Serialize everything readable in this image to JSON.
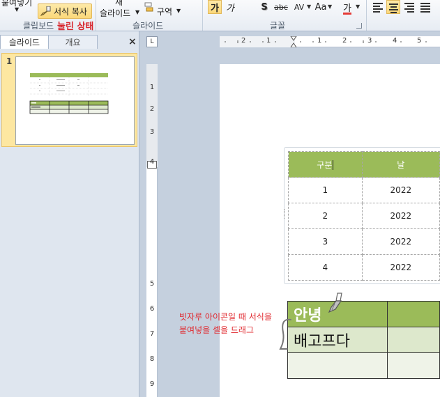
{
  "ribbon": {
    "paste_label": "붙여넣기",
    "format_painter_label": "서식 복사",
    "new_slide_label_top": "새",
    "new_slide_label": "슬라이드",
    "section_label": "구역",
    "group_clipboard": "클립보드",
    "annotation_pressed": "눌린 상태",
    "group_slides": "슬라이드",
    "group_font": "글꼴",
    "font_buttons": [
      "가",
      "가",
      "S",
      "abc",
      "AV",
      "Aa",
      "가"
    ]
  },
  "left_pane": {
    "tab_slides": "슬라이드",
    "tab_outline": "개요",
    "close_glyph": "×",
    "slide_number": "1"
  },
  "ruler": {
    "corner_glyph": "L",
    "horizontal": [
      "2",
      "1",
      "1",
      "2",
      "3",
      "4",
      "5"
    ],
    "vertical": [
      "1",
      "2",
      "3",
      "4",
      "5",
      "6",
      "7",
      "8",
      "9"
    ]
  },
  "slide": {
    "table1": {
      "headers": [
        "구분",
        "날"
      ],
      "rows": [
        [
          "1",
          "2022"
        ],
        [
          "2",
          "2022"
        ],
        [
          "3",
          "2022"
        ],
        [
          "4",
          "2022"
        ]
      ]
    },
    "table2": {
      "rows": [
        [
          "안녕",
          ""
        ],
        [
          "배고프다",
          ""
        ],
        [
          "",
          ""
        ]
      ]
    },
    "annotation_line1": "빗자루 아이콘일 때 서식을",
    "annotation_line2": "붙여넣을 셀을 드래그"
  },
  "colors": {
    "accent_green": "#9bbb59",
    "annotation_red": "#e0282e",
    "highlight_yellow": "#fbd87a"
  }
}
